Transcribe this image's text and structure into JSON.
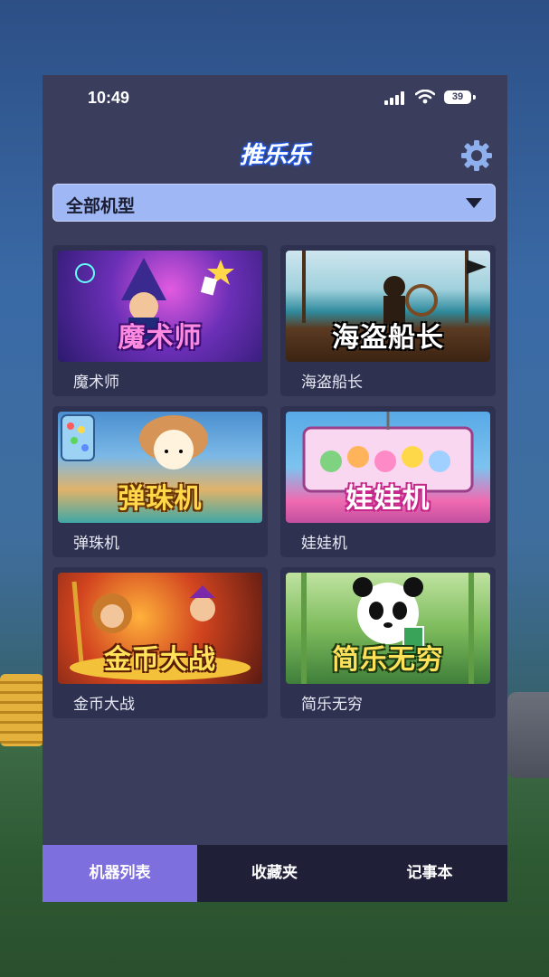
{
  "status_bar": {
    "time": "10:49",
    "battery": "39"
  },
  "header": {
    "logo": "推乐乐",
    "settings_icon": "gear-icon"
  },
  "filter": {
    "selected": "全部机型"
  },
  "games": [
    {
      "label": "魔术师",
      "thumb_title": "魔术师",
      "theme": "magician"
    },
    {
      "label": "海盗船长",
      "thumb_title": "海盗船长",
      "theme": "pirate"
    },
    {
      "label": "弹珠机",
      "thumb_title": "弹珠机",
      "theme": "pinball"
    },
    {
      "label": "娃娃机",
      "thumb_title": "娃娃机",
      "theme": "claw"
    },
    {
      "label": "金币大战",
      "thumb_title": "金币大战",
      "theme": "coinbattle"
    },
    {
      "label": "简乐无穷",
      "thumb_title": "简乐无穷",
      "theme": "panda"
    }
  ],
  "tabs": [
    {
      "label": "机器列表",
      "active": true
    },
    {
      "label": "收藏夹",
      "active": false
    },
    {
      "label": "记事本",
      "active": false
    }
  ],
  "colors": {
    "panel": "#3a3d5c",
    "card": "#2e3150",
    "dropdown": "#9fb7f4",
    "tab_active": "#7e6fde",
    "tabbar": "#1f2038"
  }
}
